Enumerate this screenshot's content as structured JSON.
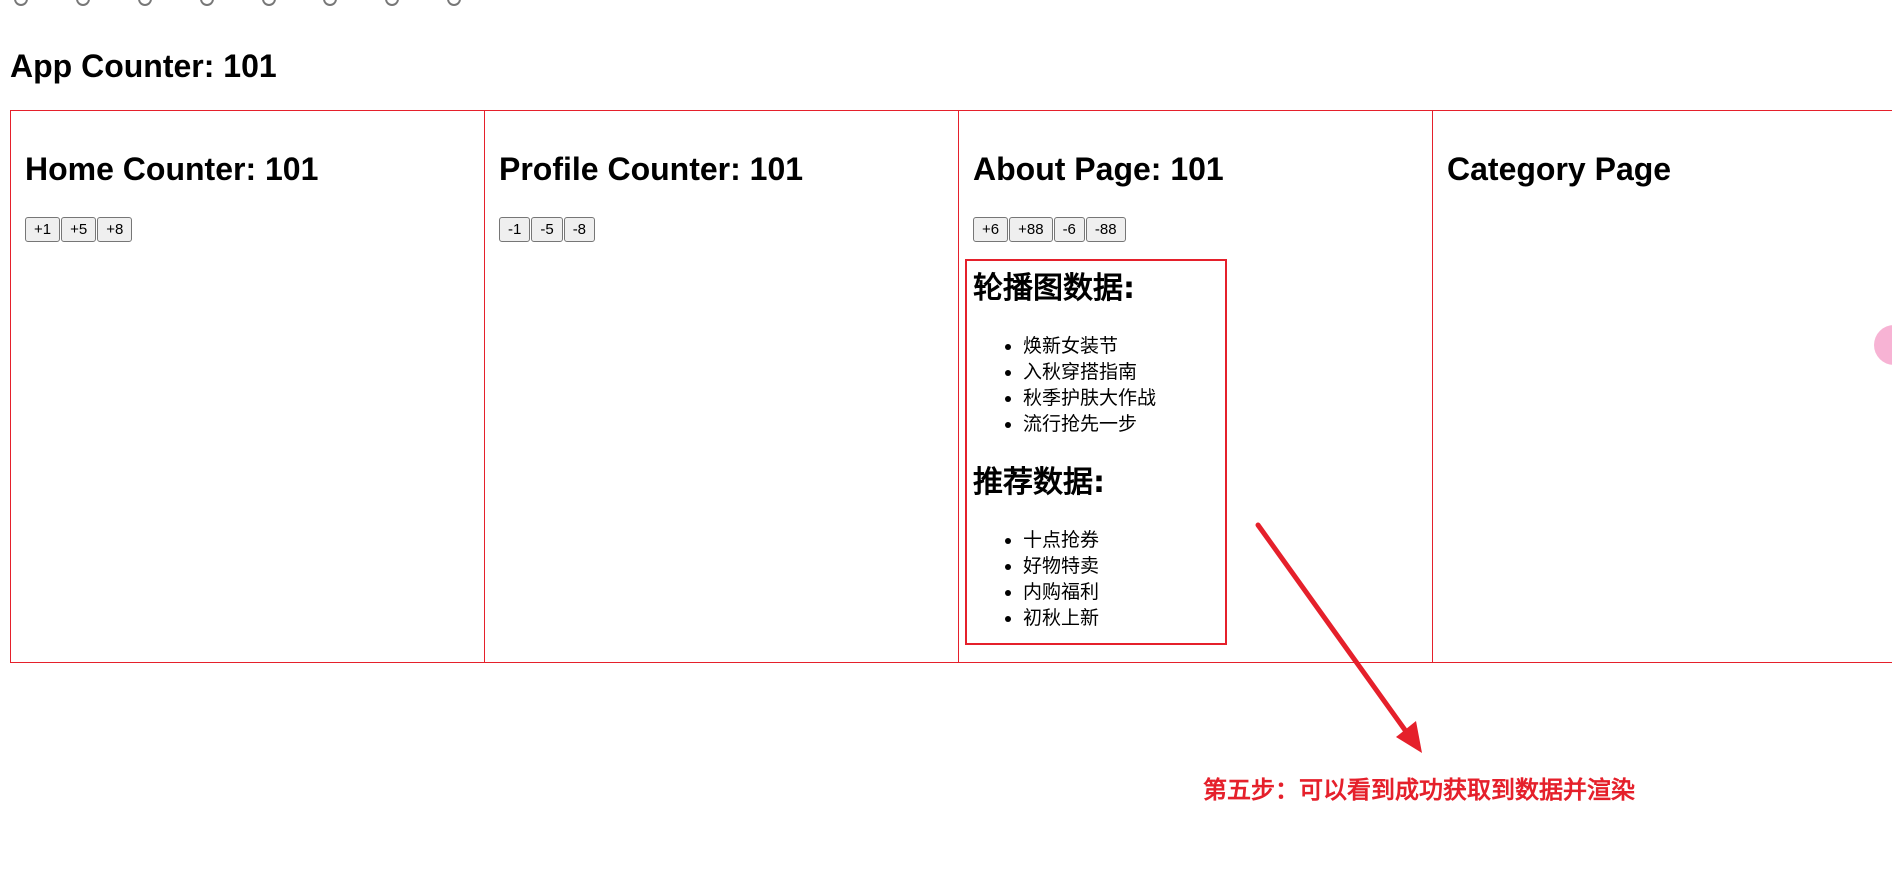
{
  "app": {
    "title": "App Counter: 101"
  },
  "columns": {
    "home": {
      "title": "Home Counter: 101",
      "buttons": [
        "+1",
        "+5",
        "+8"
      ]
    },
    "profile": {
      "title": "Profile Counter: 101",
      "buttons": [
        "-1",
        "-5",
        "-8"
      ]
    },
    "about": {
      "title": "About Page: 101",
      "buttons": [
        "+6",
        "+88",
        "-6",
        "-88"
      ],
      "banner_heading": "轮播图数据:",
      "banner_items": [
        "焕新女装节",
        "入秋穿搭指南",
        "秋季护肤大作战",
        "流行抢先一步"
      ],
      "recommend_heading": "推荐数据:",
      "recommend_items": [
        "十点抢券",
        "好物特卖",
        "内购福利",
        "初秋上新"
      ]
    },
    "category": {
      "title": "Category Page"
    }
  },
  "annotation": {
    "text": "第五步：可以看到成功获取到数据并渲染",
    "color": "#e5202b"
  },
  "colors": {
    "border": "#e5202b",
    "annotation": "#e5202b"
  }
}
